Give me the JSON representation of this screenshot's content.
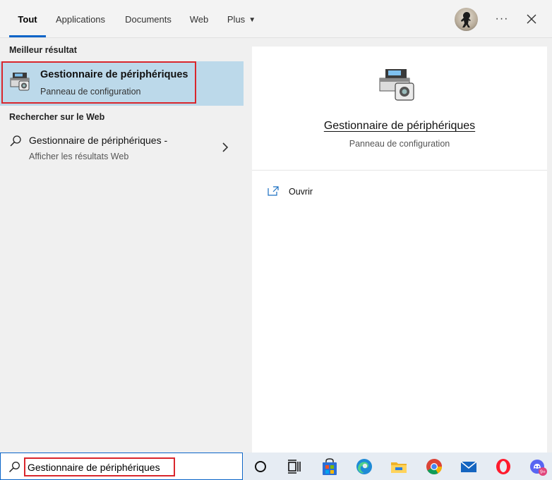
{
  "tabs": [
    {
      "label": "Tout",
      "active": true
    },
    {
      "label": "Applications",
      "active": false
    },
    {
      "label": "Documents",
      "active": false
    },
    {
      "label": "Web",
      "active": false
    },
    {
      "label": "Plus",
      "active": false
    }
  ],
  "header": {
    "more_label": "···"
  },
  "left": {
    "best_title": "Meilleur résultat",
    "best_item": {
      "title": "Gestionnaire de périphériques",
      "subtitle": "Panneau de configuration",
      "icon": "device-manager-icon"
    },
    "web_title": "Rechercher sur le Web",
    "web_item": {
      "title": "Gestionnaire de périphériques -",
      "subtitle": "Afficher les résultats Web",
      "icon": "search-icon"
    }
  },
  "right": {
    "title": "Gestionnaire de périphériques",
    "subtitle": "Panneau de configuration",
    "actions": [
      {
        "label": "Ouvrir",
        "icon": "open-icon"
      }
    ]
  },
  "search": {
    "value": "Gestionnaire de périphériques"
  },
  "taskbar": {
    "icons": [
      "cortana-icon",
      "task-view-icon",
      "store-icon",
      "edge-icon",
      "file-explorer-icon",
      "chrome-icon",
      "mail-icon",
      "opera-icon",
      "discord-icon"
    ],
    "discord_badge": "9+"
  },
  "colors": {
    "accent": "#0a64c8",
    "selection": "#bcd9ea",
    "highlight_border": "#d9262c"
  }
}
